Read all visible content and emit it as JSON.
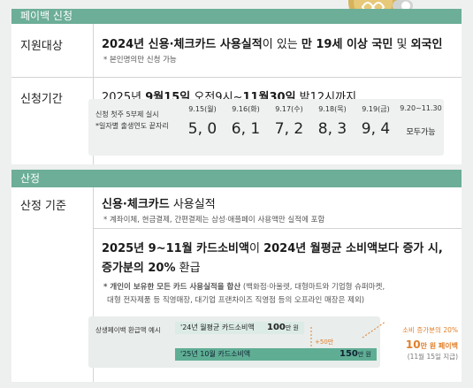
{
  "apply": {
    "section_title": "페이백 신청",
    "target": {
      "label": "지원대상",
      "text_a": "2024년 신용·체크카드 사용실적",
      "text_b": "이 있는 ",
      "text_c": "만 19세 이상 국민",
      "text_d": " 및 ",
      "text_e": "외국인",
      "note": "* 본인명의만 신청 가능"
    },
    "period": {
      "label": "신청기간",
      "text_a": "2025년 ",
      "text_b": "9월15일",
      "text_c": " 오전9시~",
      "text_d": "11월30일",
      "text_e": " 밤12시까지",
      "note_1": "신청 첫주 5부제 실시",
      "note_2": "*일자별 출생연도 끝자리",
      "columns": [
        {
          "date": "9.15(월)",
          "digits": "5, 0"
        },
        {
          "date": "9.16(화)",
          "digits": "6, 1"
        },
        {
          "date": "9.17(수)",
          "digits": "7, 2"
        },
        {
          "date": "9.18(목)",
          "digits": "8, 3"
        },
        {
          "date": "9.19(금)",
          "digits": "9, 4"
        },
        {
          "date": "9.20~11.30",
          "digits": "모두가능"
        }
      ]
    }
  },
  "calc": {
    "section_title": "산정",
    "label": "산정 기준",
    "line1_a": "신용·체크카드",
    "line1_b": " 사용실적",
    "note1": "* 계좌이체, 현금결제, 간편결제는 삼성·애플페이 사용액만 실적에 포함",
    "line2_a": "2025년 9~11월 카드소비액",
    "line2_b": "이 ",
    "line2_c": "2024년 월평균 소비액보다 증가 시,",
    "line3_a": "증가분의 20%",
    "line3_b": " 환급",
    "note2a": "* 개인이 보유한 모든 카드 사용실적을 합산",
    "note2b": " (백화점·아울렛, 대형마트와 기업형 슈퍼마켓,",
    "note2c": "대형 전자제품 등 직영매장, 대기업 프랜차이즈 직영점 등의 오프라인 매장은 제외)"
  },
  "example": {
    "label": "상생페이백 환급액 예시",
    "bar1_label": "'24년 월평균 카드소비액",
    "bar1_amount": "100",
    "bar1_unit": "만 원",
    "diff": "+50만",
    "bar2_label": "'25년 10월 카드소비액",
    "bar2_amount": "150",
    "bar2_unit": "만 원",
    "result_1": "소비 증가분의 20%",
    "result_2a": "10",
    "result_2b": "만 원 페이백",
    "result_3": "(11월 15일 지급)",
    "bar1_value": 100,
    "bar2_value": 150
  },
  "colors": {
    "header_green": "#6cae97",
    "bar_light": "#dcebe5",
    "bar_dark": "#5fae94",
    "accent_orange": "#e07f2a"
  }
}
